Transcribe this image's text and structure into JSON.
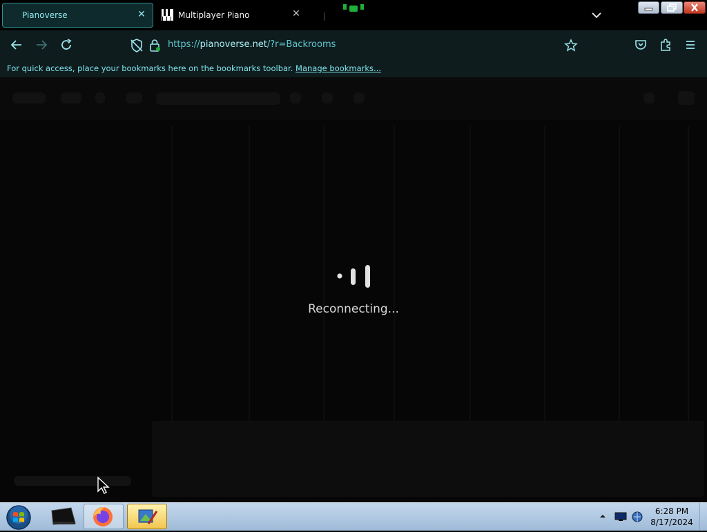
{
  "tabs": [
    {
      "title": "Pianoverse",
      "active": true
    },
    {
      "title": "Multiplayer Piano",
      "active": false
    }
  ],
  "navbar": {
    "url_prefix": "https://",
    "url_host": "pianoverse.net",
    "url_path": "/?r=Backrooms"
  },
  "bookmarks_bar": {
    "message": "For quick access, place your bookmarks here on the bookmarks toolbar.",
    "link": "Manage bookmarks..."
  },
  "page": {
    "status": "Reconnecting..."
  },
  "taskbar": {
    "time": "6:28 PM",
    "date": "8/17/2024"
  },
  "colors": {
    "accent": "#2f8f94",
    "url_text": "#5fc8cf",
    "chrome_bg": "#0f1c1e",
    "page_bg": "#060606"
  },
  "icons": [
    "back-arrow-icon",
    "forward-arrow-icon",
    "reload-icon",
    "tracking-shield-icon",
    "lock-icon",
    "bookmark-star-icon",
    "pocket-icon",
    "extensions-icon",
    "menu-icon",
    "tab-close-icon",
    "tab-list-chevron-icon",
    "spinner-icon",
    "windows-start-icon",
    "firefox-icon"
  ]
}
